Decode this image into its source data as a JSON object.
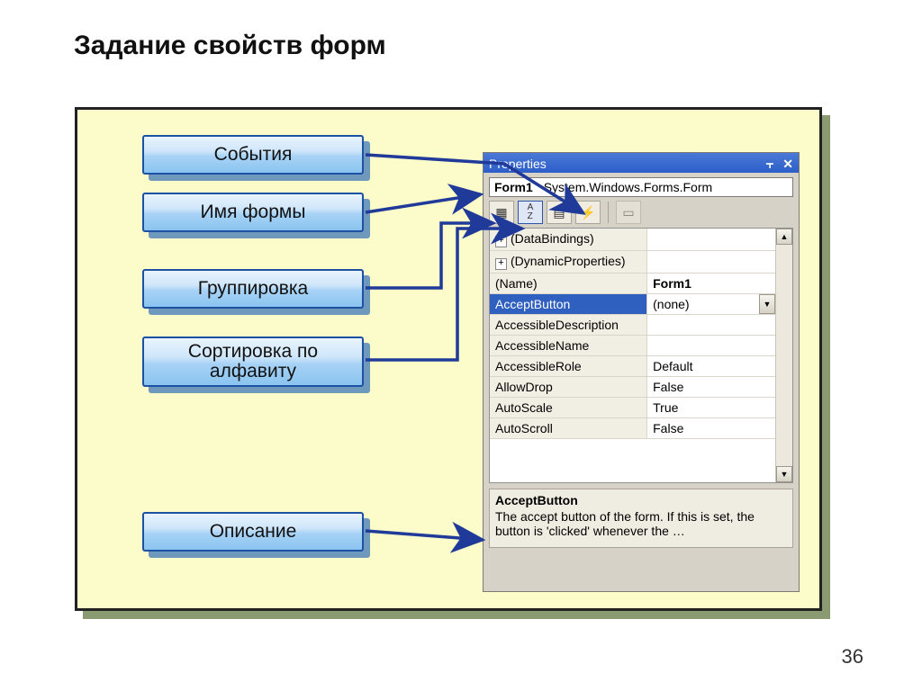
{
  "title": "Задание свойств форм",
  "pageNumber": "36",
  "labels": {
    "events": "События",
    "formName": "Имя формы",
    "grouping": "Группировка",
    "sorting": "Сортировка по алфавиту",
    "description": "Описание"
  },
  "properties": {
    "panelTitle": "Properties",
    "className": "Form1",
    "classType": "System.Windows.Forms.Form",
    "rows": [
      {
        "key": "(DataBindings)",
        "value": "",
        "expand": "+"
      },
      {
        "key": "(DynamicProperties)",
        "value": "",
        "expand": "+"
      },
      {
        "key": "(Name)",
        "value": "Form1",
        "bold": true
      },
      {
        "key": "AcceptButton",
        "value": "(none)",
        "selected": true,
        "dropdown": true
      },
      {
        "key": "AccessibleDescription",
        "value": ""
      },
      {
        "key": "AccessibleName",
        "value": ""
      },
      {
        "key": "AccessibleRole",
        "value": "Default"
      },
      {
        "key": "AllowDrop",
        "value": "False"
      },
      {
        "key": "AutoScale",
        "value": "True"
      },
      {
        "key": "AutoScroll",
        "value": "False"
      }
    ],
    "descTitle": "AcceptButton",
    "descText": "The accept button of the form. If this is set, the button is 'clicked' whenever the …"
  },
  "icons": {
    "pin": "⫟",
    "close": "✕",
    "categorized": "▦",
    "alpha": "A↓Z",
    "propPages": "▤",
    "events": "⚡",
    "doc": "▭",
    "arrowUp": "▲",
    "arrowDown": "▼"
  }
}
